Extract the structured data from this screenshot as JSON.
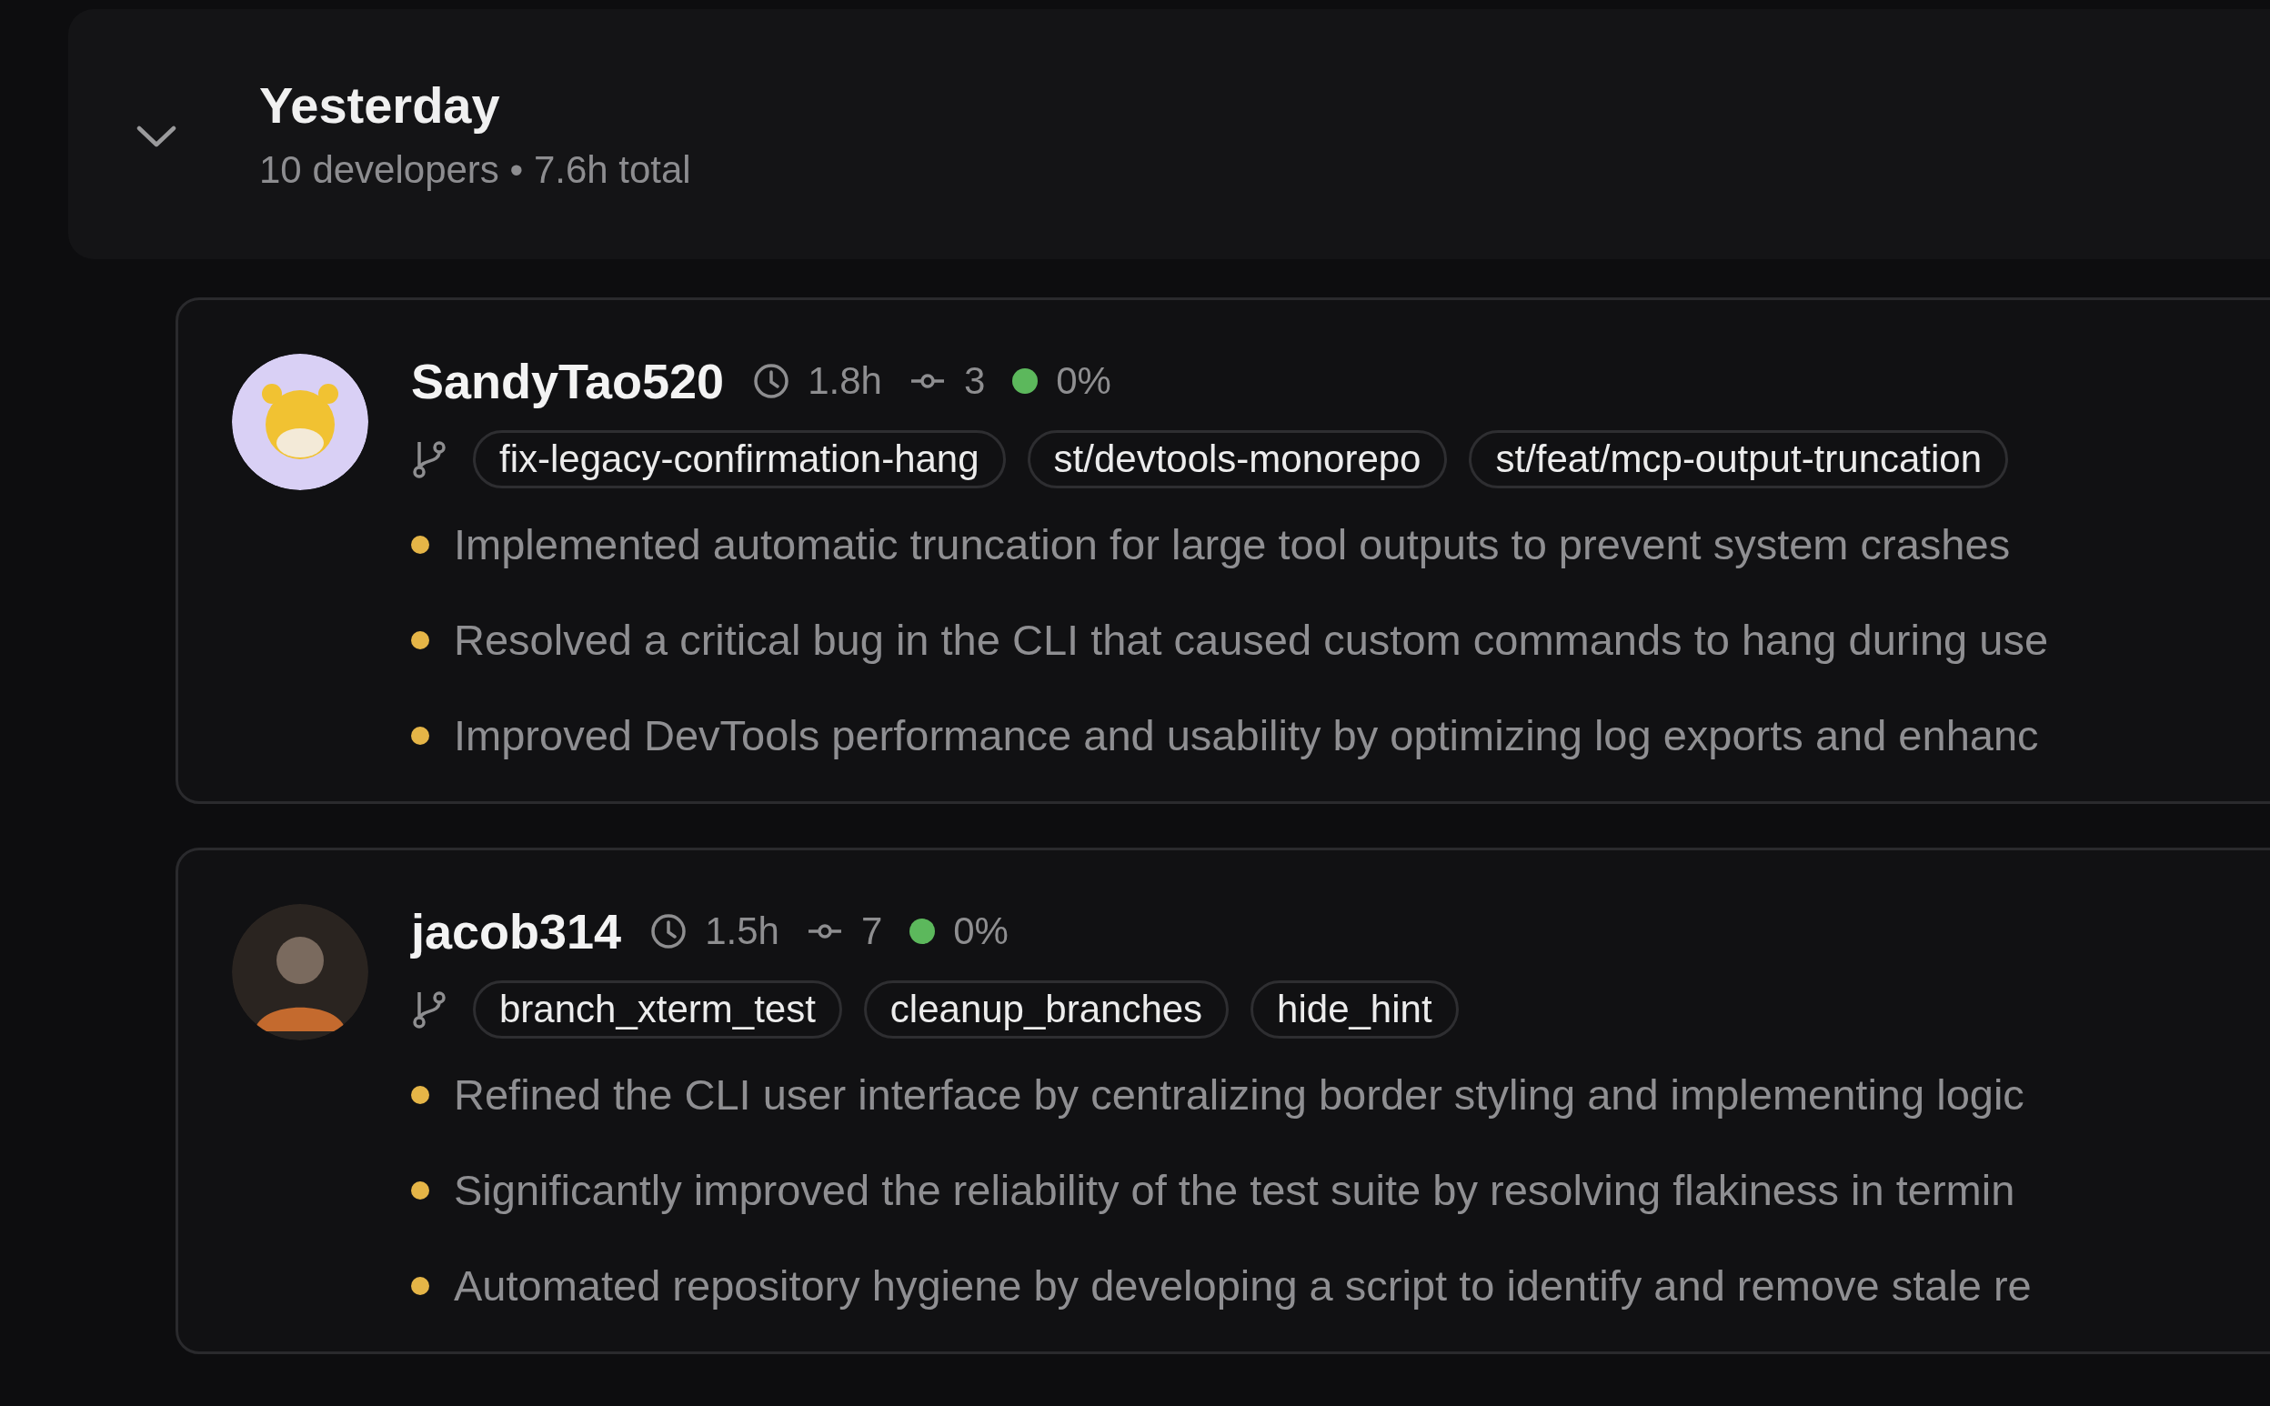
{
  "group": {
    "title": "Yesterday",
    "summary": "10 developers • 7.6h total",
    "expanded": true
  },
  "developers": [
    {
      "name": "SandyTao520",
      "avatar": {
        "kind": "illustration"
      },
      "hours": "1.8h",
      "commits": "3",
      "rate": {
        "text": "0%",
        "color": "#5cb85c"
      },
      "branches": [
        "fix-legacy-confirmation-hang",
        "st/devtools-monorepo",
        "st/feat/mcp-output-truncation"
      ],
      "highlights": [
        "Implemented automatic truncation for large tool outputs to prevent system crashes",
        "Resolved a critical bug in the CLI that caused custom commands to hang during use",
        "Improved DevTools performance and usability by optimizing log exports and enhanc"
      ]
    },
    {
      "name": "jacob314",
      "avatar": {
        "kind": "photo"
      },
      "hours": "1.5h",
      "commits": "7",
      "rate": {
        "text": "0%",
        "color": "#5cb85c"
      },
      "branches": [
        "branch_xterm_test",
        "cleanup_branches",
        "hide_hint"
      ],
      "highlights": [
        "Refined the CLI user interface by centralizing border styling and implementing logic",
        "Significantly improved the reliability of the test suite by resolving flakiness in termin",
        "Automated repository hygiene by developing a script to identify and remove stale re"
      ]
    }
  ]
}
